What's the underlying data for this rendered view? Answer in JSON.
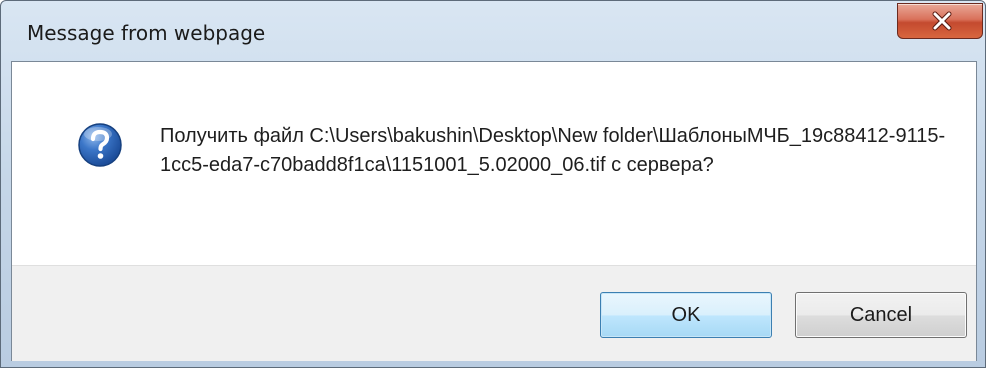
{
  "window": {
    "title": "Message from webpage"
  },
  "icons": {
    "close": "close-icon",
    "message": "question-icon"
  },
  "message": {
    "text": "Получить файл C:\\Users\\bakushin\\Desktop\\New folder\\ШаблоныМЧБ_19c88412-9115-1cc5-eda7-c70badd8f1ca\\1151001_5.02000_06.tif с сервера?"
  },
  "buttons": {
    "ok_label": "OK",
    "cancel_label": "Cancel"
  },
  "colors": {
    "close_button": "#c44a2f",
    "ok_button_border": "#3c7fb1",
    "question_icon": "#2a62b4"
  }
}
